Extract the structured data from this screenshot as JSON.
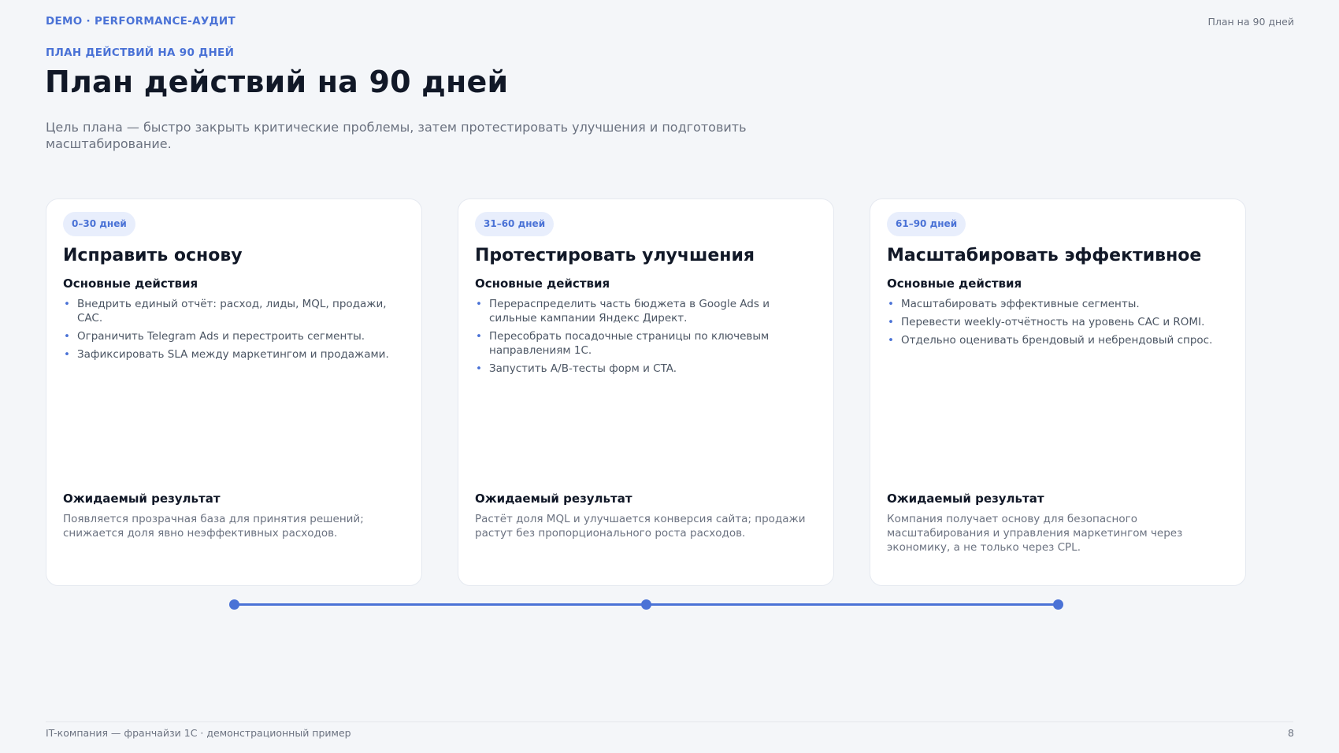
{
  "header": {
    "brand": "DEMO · PERFORMANCE-АУДИТ",
    "right_label": "План на 90 дней"
  },
  "eyebrow": "ПЛАН ДЕЙСТВИЙ НА 90 ДНЕЙ",
  "title": "План действий на 90 дней",
  "subtitle": "Цель плана — быстро закрыть критические проблемы, затем протестировать улучшения и подготовить масштабирование.",
  "phases": [
    {
      "period": "0–30 дней",
      "title": "Исправить основу",
      "actions_label": "Основные действия",
      "actions": [
        "Внедрить единый отчёт: расход, лиды, MQL, продажи, CAC.",
        "Ограничить Telegram Ads и перестроить сегменты.",
        "Зафиксировать SLA между маркетингом и продажами."
      ],
      "result_label": "Ожидаемый результат",
      "result": "Появляется прозрачная база для принятия решений; снижается доля явно неэффективных расходов."
    },
    {
      "period": "31–60 дней",
      "title": "Протестировать улучшения",
      "actions_label": "Основные действия",
      "actions": [
        "Перераспределить часть бюджета в Google Ads и сильные кампании Яндекс Директ.",
        "Пересобрать посадочные страницы по ключевым направлениям 1С.",
        "Запустить A/B-тесты форм и CTA."
      ],
      "result_label": "Ожидаемый результат",
      "result": "Растёт доля MQL и улучшается конверсия сайта; продажи растут без пропорционального роста расходов."
    },
    {
      "period": "61–90 дней",
      "title": "Масштабировать эффективное",
      "actions_label": "Основные действия",
      "actions": [
        "Масштабировать эффективные сегменты.",
        "Перевести weekly-отчётность на уровень CAC и ROMI.",
        "Отдельно оценивать брендовый и небрендовый спрос."
      ],
      "result_label": "Ожидаемый результат",
      "result": "Компания получает основу для безопасного масштабирования и управления маркетингом через экономику, а не только через CPL."
    }
  ],
  "footer": {
    "left": "IT-компания — франчайзи 1С · демонстрационный пример",
    "page_number": "8"
  },
  "colors": {
    "accent": "#4a72d6",
    "background": "#f4f6f9",
    "card": "#ffffff",
    "pill_bg": "#e8eefc"
  }
}
